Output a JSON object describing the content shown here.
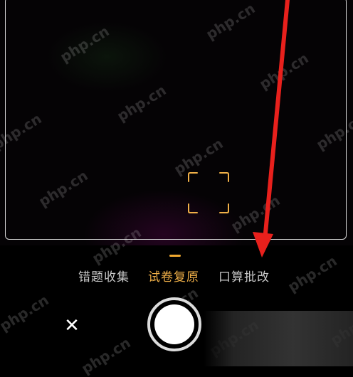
{
  "modes": {
    "items": [
      {
        "label": "错题收集",
        "active": false
      },
      {
        "label": "试卷复原",
        "active": true
      },
      {
        "label": "口算批改",
        "active": false
      }
    ],
    "active_color": "#f0b048",
    "inactive_color": "#c8c8c8"
  },
  "controls": {
    "close_icon": "✕",
    "shutter": "shutter-button",
    "gallery": "gallery-thumbnail"
  },
  "annotation": {
    "arrow_color": "#e8201c"
  },
  "watermark": {
    "text": "php.cn"
  }
}
